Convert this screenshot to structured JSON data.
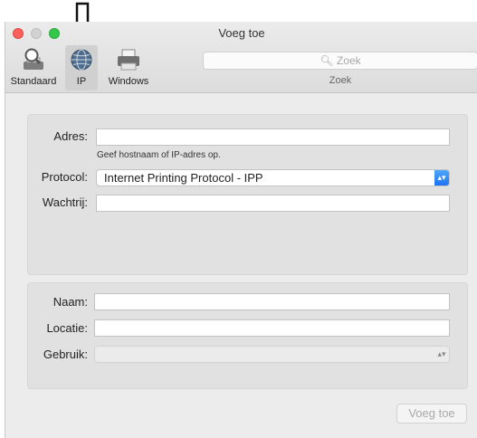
{
  "window": {
    "title": "Voeg toe"
  },
  "toolbar": {
    "items": [
      {
        "label": "Standaard",
        "icon": "magnifier-printer-icon"
      },
      {
        "label": "IP",
        "icon": "globe-icon"
      },
      {
        "label": "Windows",
        "icon": "printer-icon"
      }
    ],
    "search_placeholder": "Zoek",
    "search_label": "Zoek"
  },
  "form": {
    "address_label": "Adres:",
    "address_value": "",
    "address_hint": "Geef hostnaam of IP-adres op.",
    "protocol_label": "Protocol:",
    "protocol_value": "Internet Printing Protocol - IPP",
    "queue_label": "Wachtrij:",
    "queue_value": "",
    "name_label": "Naam:",
    "name_value": "",
    "location_label": "Locatie:",
    "location_value": "",
    "use_label": "Gebruik:",
    "use_value": ""
  },
  "add_button": "Voeg toe",
  "colors": {
    "accent": "#1e74f2",
    "close": "#fc605c",
    "maximize": "#34c84a"
  }
}
